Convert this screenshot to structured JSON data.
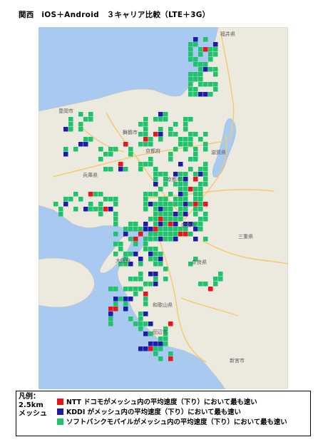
{
  "title": "関西　iOS＋Android　３キャリア比較（LTE＋3G）",
  "colors": {
    "ntt": "#e8161b",
    "kddi": "#1c1caa",
    "softbank": "#1ec36b",
    "sea": "#a8c9f0",
    "land": "#ece9df"
  },
  "map_labels": [
    "豊岡市",
    "京都府",
    "兵庫県",
    "大阪府",
    "奈良県",
    "三重県",
    "和歌山県",
    "滋賀県",
    "福井県",
    "舞鶴市",
    "京都市",
    "奈良市",
    "新宮市",
    "田辺市"
  ],
  "legend": {
    "heading": [
      "凡例：",
      "2.5km",
      "メッシュ"
    ],
    "items": [
      {
        "color": "#e8161b",
        "label": "NTT ドコモがメッシュ内の平均速度（下り）において最も速い"
      },
      {
        "color": "#1c1caa",
        "label": "KDDI がメッシュ内の平均速度（下り）において最も速い"
      },
      {
        "color": "#1ec36b",
        "label": "ソフトバンクモバイルがメッシュ内の平均速度（下り）において最も速い"
      }
    ]
  }
}
